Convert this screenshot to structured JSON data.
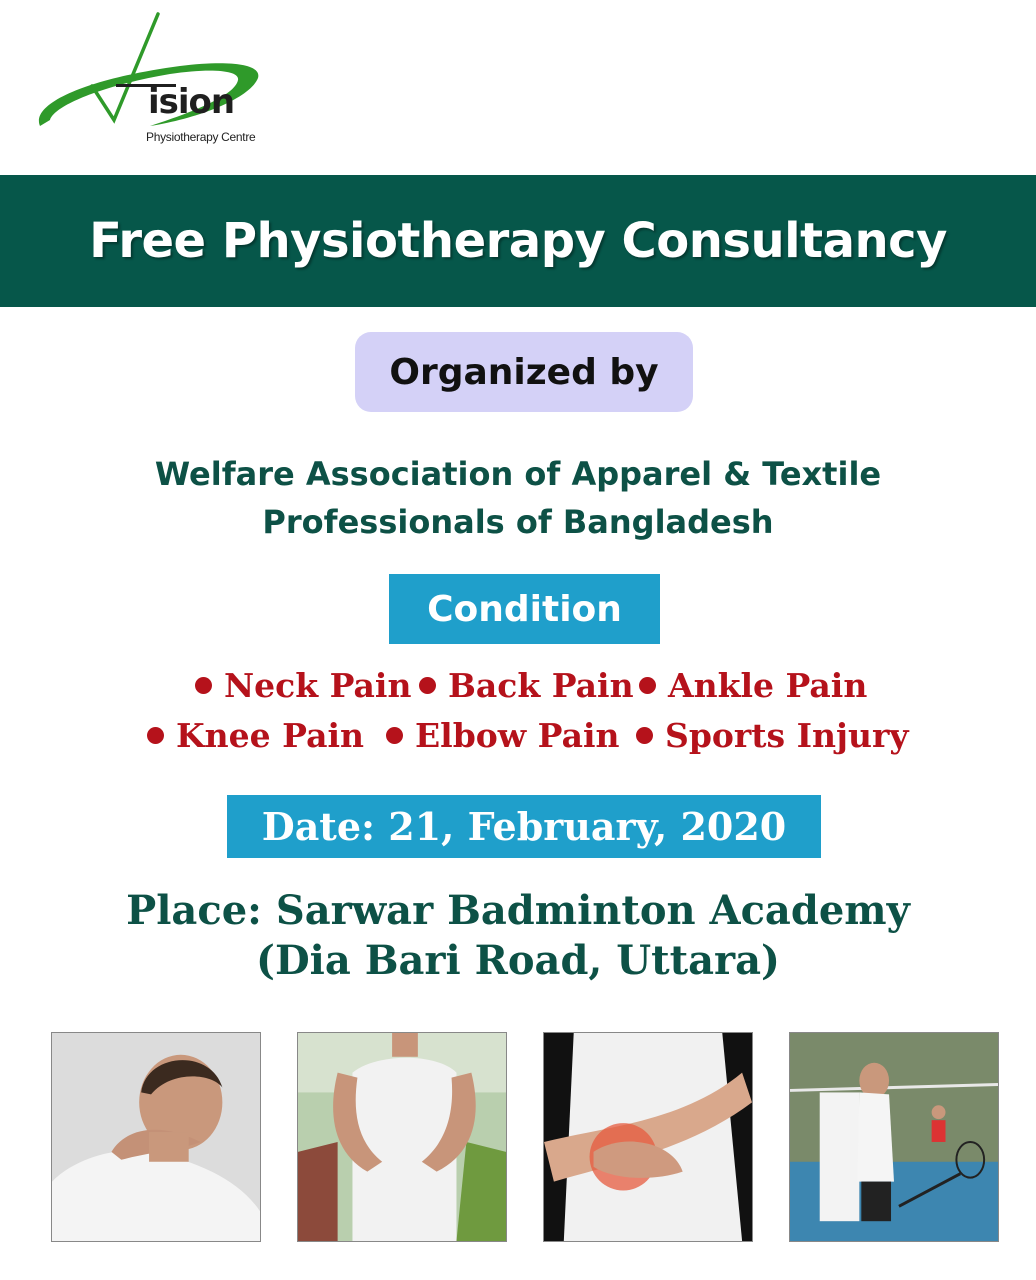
{
  "logo": {
    "word": "ision",
    "subtitle": "Physiotherapy Centre",
    "icon": "vision-swoosh-logo",
    "colors": {
      "green": "#2f9a2a",
      "dark": "#1f1f1f"
    }
  },
  "title": "Free Physiotherapy Consultancy",
  "organized_label": "Organized by",
  "organizer": {
    "line1": "Welfare Association of Apparel & Textile",
    "line2": "Professionals of Bangladesh"
  },
  "condition_label": "Condition",
  "conditions": [
    "Neck Pain",
    "Back Pain",
    "Ankle Pain",
    "Knee Pain",
    "Elbow Pain",
    "Sports Injury"
  ],
  "date": "Date: 21, February, 2020",
  "place": {
    "line1": "Place: Sarwar Badminton Academy",
    "line2": "(Dia Bari Road, Uttara)"
  },
  "photos": [
    {
      "icon": "neck-pain-photo"
    },
    {
      "icon": "back-pain-photo"
    },
    {
      "icon": "elbow-pain-photo"
    },
    {
      "icon": "sports-injury-photo"
    }
  ],
  "colors": {
    "band": "#06574a",
    "pill": "#d4d1f7",
    "accent_blue": "#1f9fcb",
    "condition_red": "#b5121b",
    "text_green": "#0d5146"
  }
}
